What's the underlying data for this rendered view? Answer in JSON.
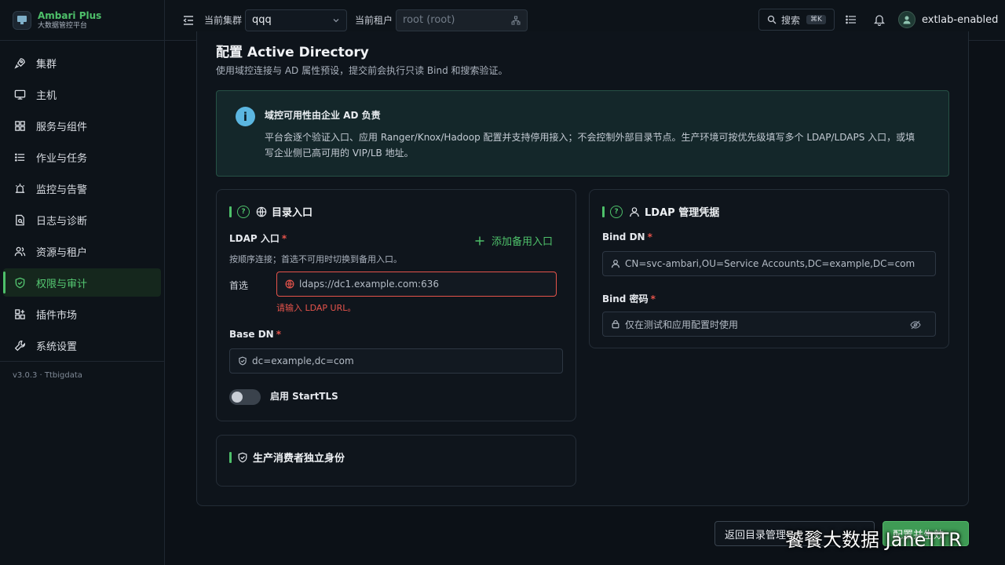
{
  "brand": {
    "title": "Ambari Plus",
    "subtitle": "大数据管控平台"
  },
  "sidebar": {
    "items": [
      {
        "label": "集群",
        "icon": "rocket-icon"
      },
      {
        "label": "主机",
        "icon": "monitor-icon"
      },
      {
        "label": "服务与组件",
        "icon": "grid-icon"
      },
      {
        "label": "作业与任务",
        "icon": "list-icon"
      },
      {
        "label": "监控与告警",
        "icon": "alarm-icon"
      },
      {
        "label": "日志与诊断",
        "icon": "doc-search-icon"
      },
      {
        "label": "资源与租户",
        "icon": "users-icon"
      },
      {
        "label": "权限与审计",
        "icon": "shield-check-icon",
        "active": true
      },
      {
        "label": "插件市场",
        "icon": "plugin-icon"
      },
      {
        "label": "系统设置",
        "icon": "wrench-icon"
      }
    ],
    "version": "v3.0.3 · Ttbigdata"
  },
  "topbar": {
    "cluster_label": "当前集群",
    "cluster_value": "qqq",
    "tenant_label": "当前租户",
    "tenant_value": "root (root)",
    "search_label": "搜索",
    "search_shortcut": "⌘K",
    "username": "extlab-enabled"
  },
  "page": {
    "title": "配置 Active Directory",
    "subtitle": "使用域控连接与 AD 属性预设，提交前会执行只读 Bind 和搜索验证。"
  },
  "alert": {
    "title": "域控可用性由企业 AD 负责",
    "body": "平台会逐个验证入口、应用 Ranger/Knox/Hadoop 配置并支持停用接入；不会控制外部目录节点。生产环境可按优先级填写多个 LDAP/LDAPS 入口，或填写企业侧已高可用的 VIP/LB 地址。"
  },
  "directory_card": {
    "title": "目录入口",
    "ldap_label": "LDAP 入口",
    "add_backup": "添加备用入口",
    "ldap_hint": "按顺序连接；首选不可用时切换到备用入口。",
    "primary_label": "首选",
    "primary_value": "ldaps://dc1.example.com:636",
    "primary_error": "请输入 LDAP URL。",
    "base_dn_label": "Base DN",
    "base_dn_value": "dc=example,dc=com",
    "starttls_label": "启用 StartTLS"
  },
  "credential_card": {
    "title": "LDAP 管理凭据",
    "bind_dn_label": "Bind DN",
    "bind_dn_value": "CN=svc-ambari,OU=Service Accounts,DC=example,DC=com",
    "bind_pw_label": "Bind 密码",
    "bind_pw_placeholder": "仅在测试和应用配置时使用"
  },
  "consumer_card": {
    "title": "生产消费者独立身份"
  },
  "footer": {
    "back_label": "返回目录管理",
    "apply_label": "配置并生效"
  },
  "watermark": "饕餮大数据 JaneTTR",
  "colors": {
    "accent": "#4ec06a",
    "error": "#e5534b",
    "info": "#5bb6e0"
  }
}
